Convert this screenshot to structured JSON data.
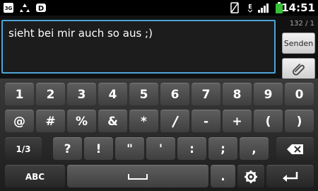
{
  "status_bar": {
    "icons": [
      "sim-3g-icon",
      "recycle-icon",
      "d-app-icon",
      "no-sim-icon",
      "network-e-icon",
      "signal-icon",
      "battery-icon"
    ],
    "time": "14:51"
  },
  "compose": {
    "message_text": "sieht bei mir auch so aus ;)",
    "counter": "132 / 1",
    "send_label": "Senden",
    "attach_icon": "paperclip-icon"
  },
  "keyboard": {
    "row1": [
      "1",
      "2",
      "3",
      "4",
      "5",
      "6",
      "7",
      "8",
      "9",
      "0"
    ],
    "row2": [
      "@",
      "#",
      "%",
      "&",
      "*",
      "-",
      "+",
      "(",
      ")"
    ],
    "row3": [
      "1/3",
      "?",
      "!",
      "\"",
      "'",
      ":",
      ";",
      ","
    ],
    "row4": {
      "abc_label": "ABC",
      "period": ".",
      "space_icon": "space-bar-icon",
      "settings_icon": "gear-icon",
      "enter_icon": "enter-arrow-icon",
      "backspace_icon": "backspace-icon"
    }
  },
  "colors": {
    "accent_border": "#4ba4d6",
    "key_face": "#4f4f4f",
    "battery_green": "#35c135"
  }
}
